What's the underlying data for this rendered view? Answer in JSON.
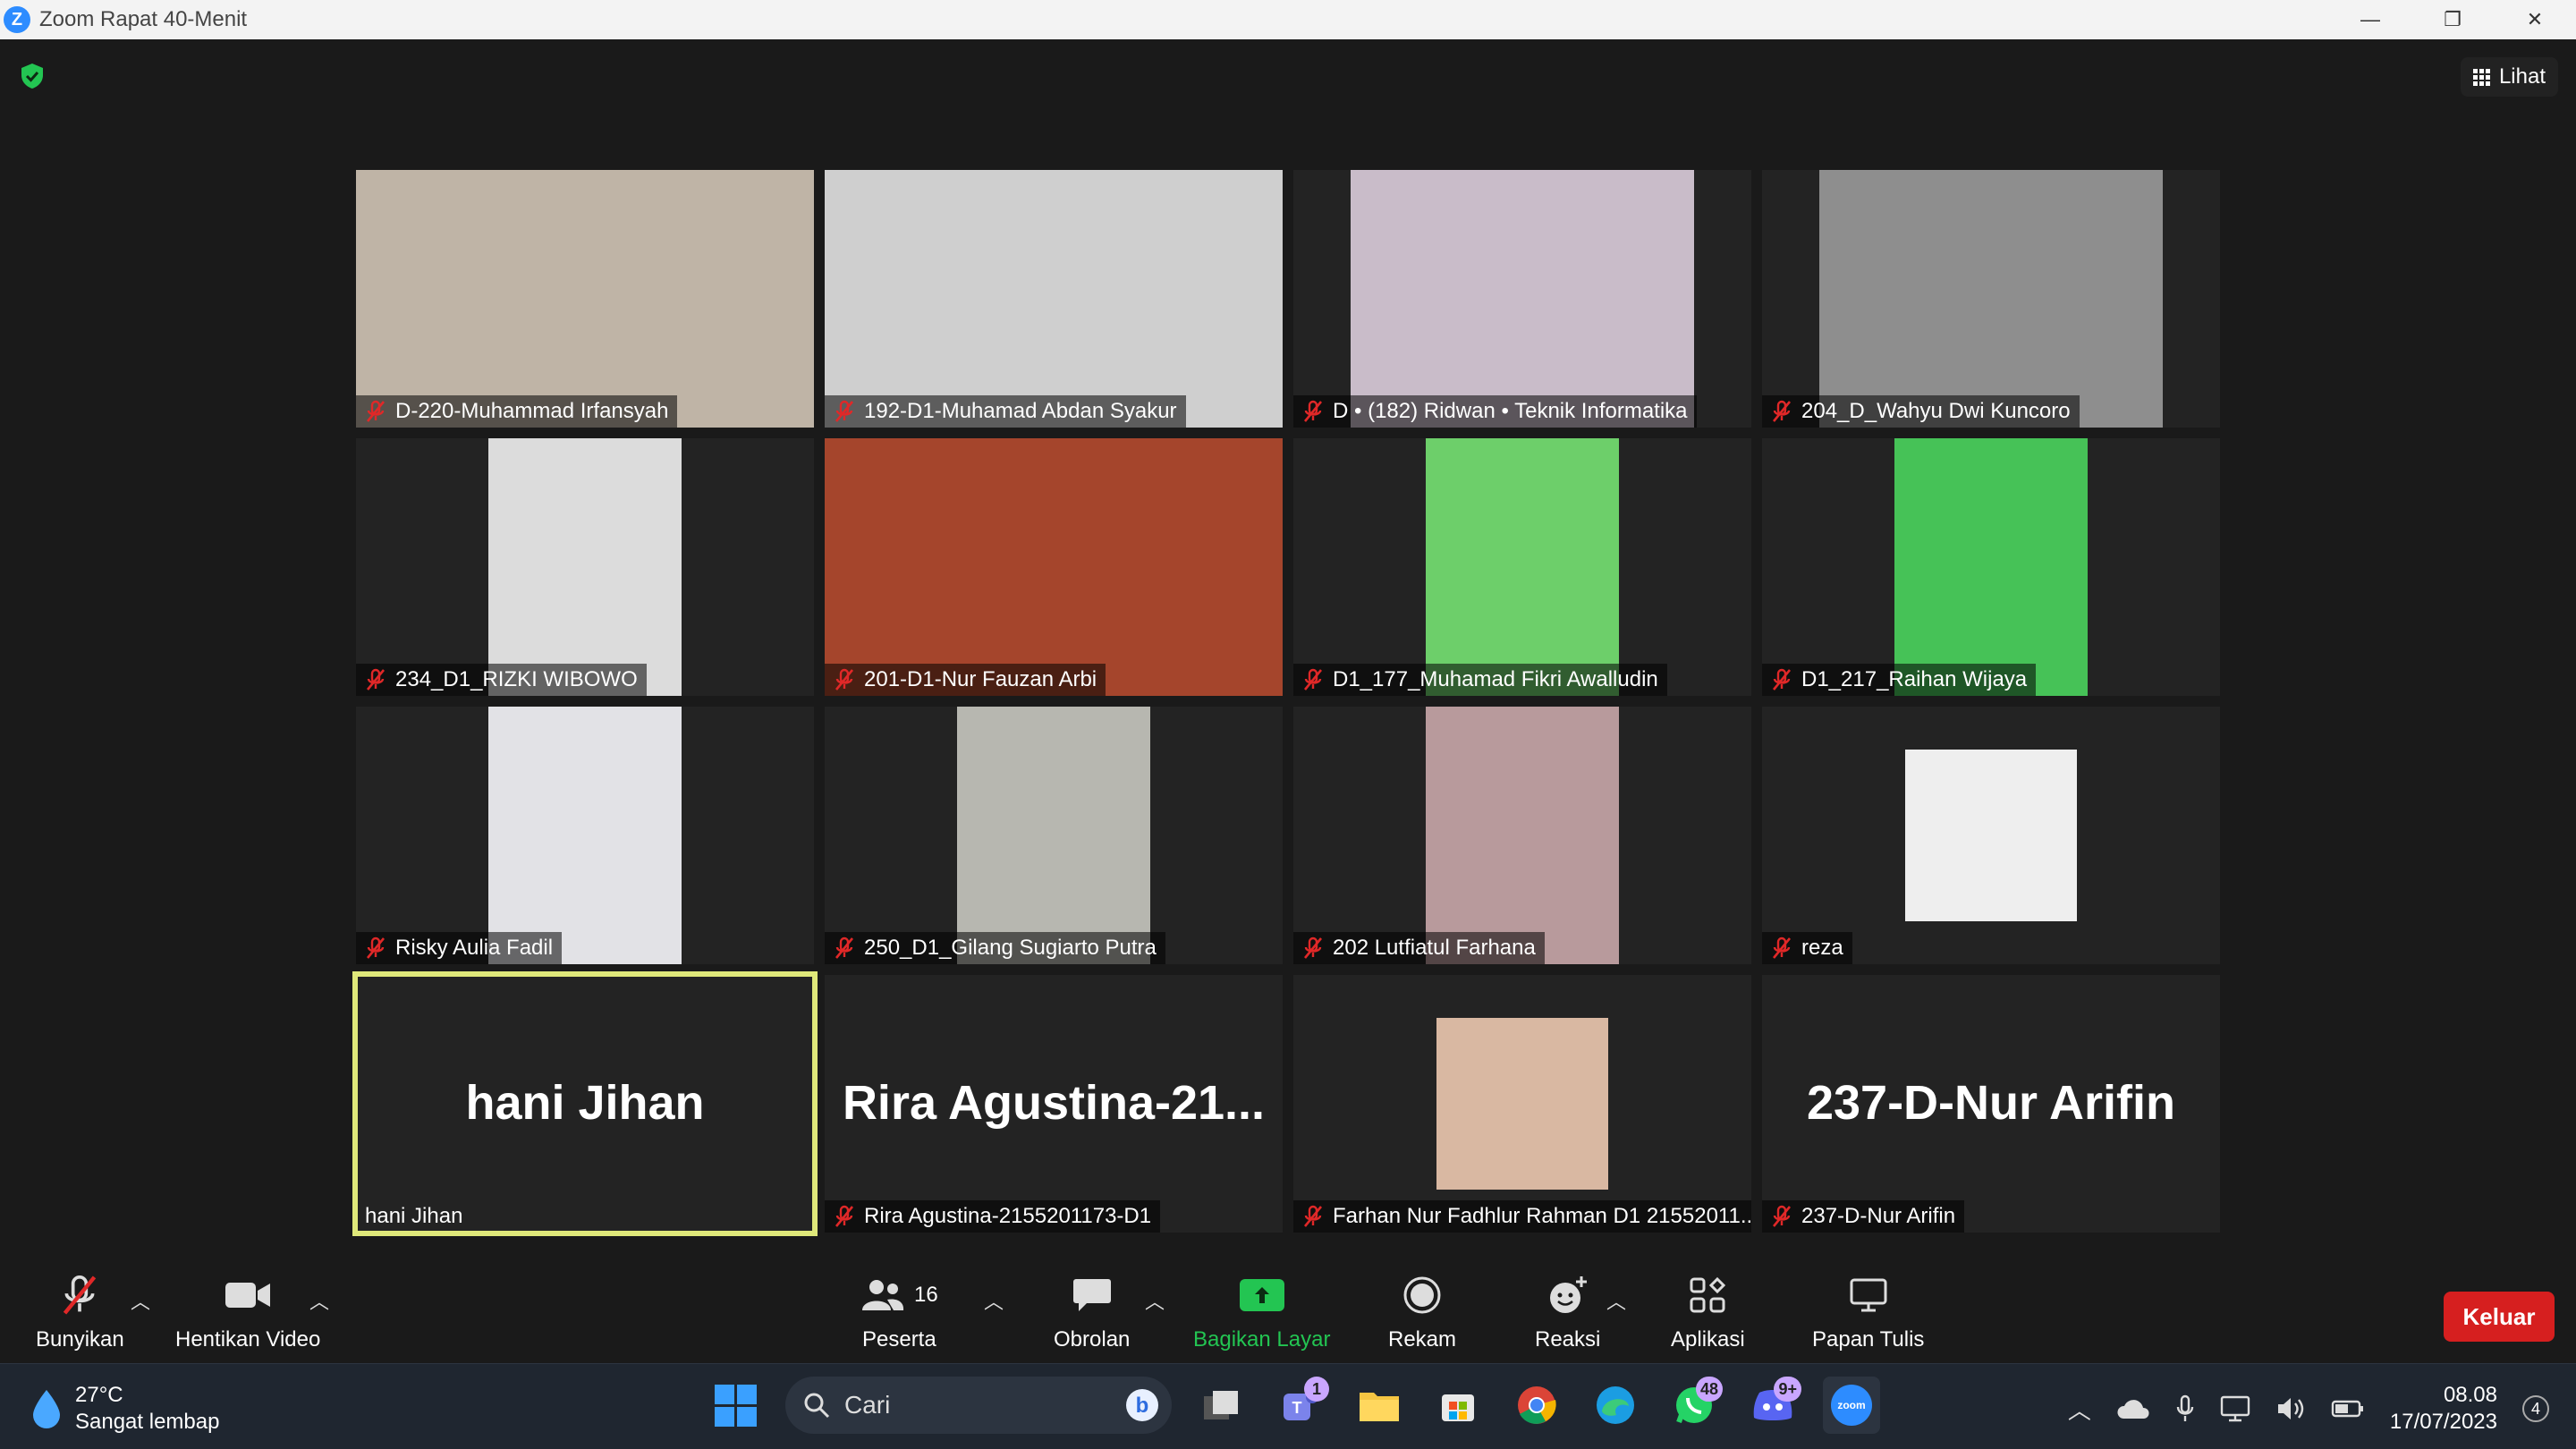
{
  "window": {
    "title": "Zoom Rapat 40-Menit",
    "logo_letter": "Z",
    "minimize": "—",
    "restore": "❐",
    "close": "✕"
  },
  "view_button": {
    "label": "Lihat"
  },
  "participants": [
    {
      "name": "D-220-Muhammad Irfansyah",
      "muted": true,
      "video_bg": "#bfb4a6"
    },
    {
      "name": "192-D1-Muhamad Abdan Syakur",
      "muted": true,
      "video_bg": "#cfcfcf"
    },
    {
      "name": "D • (182) Ridwan • Teknik Informatika",
      "muted": true,
      "video_bg": "#c9bcc9"
    },
    {
      "name": "204_D_Wahyu Dwi Kuncoro",
      "muted": true,
      "video_bg": "#8e8e8e"
    },
    {
      "name": "234_D1_RIZKI WIBOWO",
      "muted": true,
      "video_bg": "#dcdcdc"
    },
    {
      "name": "201-D1-Nur Fauzan Arbi",
      "muted": true,
      "video_bg": "#a5452c"
    },
    {
      "name": "D1_177_Muhamad Fikri Awalludin",
      "muted": true,
      "video_bg": "#6dcf6a"
    },
    {
      "name": "D1_217_Raihan Wijaya",
      "muted": true,
      "video_bg": "#46c257"
    },
    {
      "name": "Risky Aulia Fadil",
      "muted": true,
      "video_bg": "#e2e2e6"
    },
    {
      "name": "250_D1_Gilang Sugiarto Putra",
      "muted": true,
      "video_bg": "#b7b7b0"
    },
    {
      "name": "202 Lutfiatul Farhana",
      "muted": true,
      "video_bg": "#b89a9c"
    },
    {
      "name": "reza",
      "muted": true,
      "video_bg": "#eeeeee"
    },
    {
      "name": "hani Jihan",
      "muted": false,
      "display_name": "hani Jihan"
    },
    {
      "name": "Rira Agustina-2155201173-D1",
      "muted": true,
      "display_name": "Rira  Agustina-21..."
    },
    {
      "name": "Farhan Nur Fadhlur Rahman D1 21552011...",
      "muted": true,
      "video_bg": "#d9b8a2"
    },
    {
      "name": "237-D-Nur Arifin",
      "muted": true,
      "display_name": "237-D-Nur Arifin"
    }
  ],
  "toolbar": {
    "unmute": "Bunyikan",
    "stop_video": "Hentikan Video",
    "participants": "Peserta",
    "participants_count": "16",
    "chat": "Obrolan",
    "share": "Bagikan Layar",
    "record": "Rekam",
    "reactions": "Reaksi",
    "apps": "Aplikasi",
    "whiteboard": "Papan Tulis",
    "leave": "Keluar"
  },
  "taskbar": {
    "temperature": "27°C",
    "weather": "Sangat lembap",
    "search": "Cari",
    "teams_badge": "1",
    "whatsapp_badge": "48",
    "discord_badge": "9+",
    "zoom_label": "zoom",
    "time": "08.08",
    "date": "17/07/2023",
    "notifications": "4"
  },
  "colors": {
    "accent_green": "#23c552",
    "leave_red": "#d61f1f",
    "active_speaker": "#dfe87a",
    "zoom_blue": "#2d8cff"
  }
}
